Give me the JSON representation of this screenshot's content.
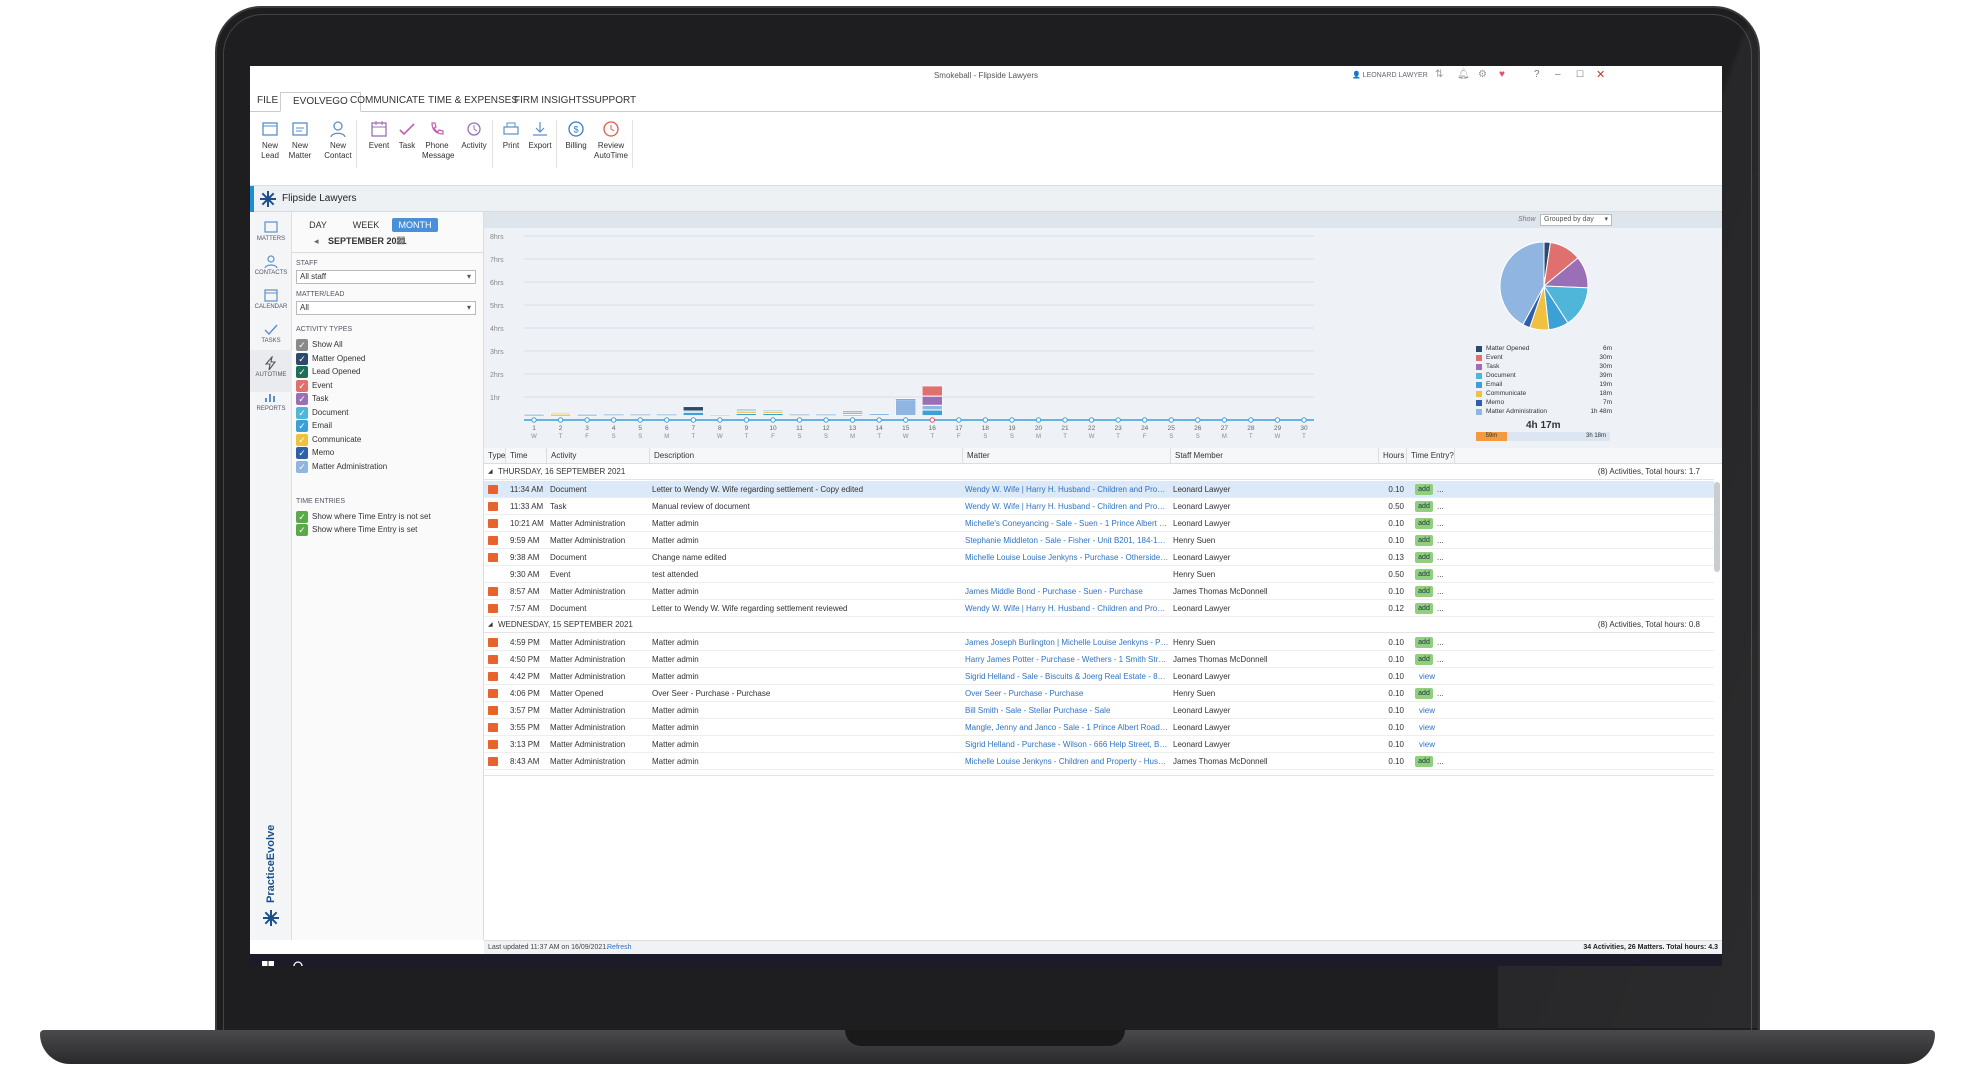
{
  "window": {
    "title": "Smokeball - Flipside Lawyers",
    "user": "LEONARD LAWYER"
  },
  "tabs": [
    "FILE",
    "EVOLVEGO",
    "COMMUNICATE",
    "TIME & EXPENSES",
    "FIRM INSIGHTS",
    "SUPPORT"
  ],
  "ribbon": [
    {
      "label": "New\nLead",
      "icon": "new-lead-icon"
    },
    {
      "label": "New\nMatter",
      "icon": "new-matter-icon"
    },
    {
      "label": "New\nContact",
      "icon": "new-contact-icon"
    },
    {
      "label": "Event",
      "icon": "event-icon"
    },
    {
      "label": "Task",
      "icon": "task-icon"
    },
    {
      "label": "Phone\nMessage",
      "icon": "phone-icon"
    },
    {
      "label": "Activity",
      "icon": "activity-icon"
    },
    {
      "label": "Print",
      "icon": "print-icon"
    },
    {
      "label": "Export",
      "icon": "export-icon"
    },
    {
      "label": "Billing",
      "icon": "billing-icon"
    },
    {
      "label": "Review\nAutoTime",
      "icon": "autotime-icon"
    }
  ],
  "firm": {
    "name": "Flipside Lawyers"
  },
  "nav": [
    "MATTERS",
    "CONTACTS",
    "CALENDAR",
    "TASKS",
    "AUTOTIME",
    "REPORTS"
  ],
  "brand": "PracticeEvolve",
  "filters": {
    "views": [
      "DAY",
      "WEEK",
      "MONTH"
    ],
    "month": "SEPTEMBER 2021",
    "staff_label": "STAFF",
    "staff_value": "All staff",
    "matter_label": "MATTER/LEAD",
    "matter_value": "All",
    "activity_label": "ACTIVITY TYPES",
    "activity_types": [
      {
        "label": "Show All",
        "color": "#8a8a8a"
      },
      {
        "label": "Matter Opened",
        "color": "#2b4a6e"
      },
      {
        "label": "Lead Opened",
        "color": "#1f6e5a"
      },
      {
        "label": "Event",
        "color": "#e07070"
      },
      {
        "label": "Task",
        "color": "#9b6fb8"
      },
      {
        "label": "Document",
        "color": "#4fb5d9"
      },
      {
        "label": "Email",
        "color": "#3aa0d6"
      },
      {
        "label": "Communicate",
        "color": "#f0c040"
      },
      {
        "label": "Memo",
        "color": "#2f5fa8"
      },
      {
        "label": "Matter Administration",
        "color": "#8fb5e0"
      }
    ],
    "time_label": "TIME ENTRIES",
    "time_options": [
      "Show where Time Entry is not set",
      "Show where Time Entry is set"
    ]
  },
  "chart_controls": {
    "show_label": "Show",
    "show_value": "Grouped by day"
  },
  "chart_data": {
    "type": "bar",
    "ylabels": [
      "8hrs",
      "7hrs",
      "6hrs",
      "5hrs",
      "4hrs",
      "3hrs",
      "2hrs",
      "1hr"
    ],
    "days": [
      "1",
      "2",
      "3",
      "4",
      "5",
      "6",
      "7",
      "8",
      "9",
      "10",
      "11",
      "12",
      "13",
      "14",
      "15",
      "16",
      "17",
      "18",
      "19",
      "20",
      "21",
      "22",
      "23",
      "24",
      "25",
      "26",
      "27",
      "28",
      "29",
      "30"
    ],
    "weekdays": [
      "W",
      "T",
      "F",
      "S",
      "S",
      "M",
      "T",
      "W",
      "T",
      "F",
      "S",
      "S",
      "M",
      "T",
      "W",
      "T",
      "F",
      "S",
      "S",
      "M",
      "T",
      "W",
      "T",
      "F",
      "S",
      "S",
      "M",
      "T",
      "W",
      "T"
    ],
    "stack_colors": [
      "#3aa0d6",
      "#f0c040",
      "#8fb5e0",
      "#9b6fb8",
      "#e07070",
      "#2b4a6e"
    ],
    "stacks": [
      [
        0.05,
        0,
        0.05,
        0,
        0,
        0
      ],
      [
        0.05,
        0.05,
        0.05,
        0,
        0,
        0
      ],
      [
        0.05,
        0,
        0.05,
        0,
        0,
        0
      ],
      [
        0,
        0,
        0,
        0,
        0,
        0
      ],
      [
        0,
        0,
        0,
        0,
        0,
        0
      ],
      [
        0,
        0,
        0,
        0,
        0,
        0
      ],
      [
        0.15,
        0,
        0.05,
        0,
        0,
        0.2
      ],
      [
        0,
        0,
        0.05,
        0,
        0,
        0
      ],
      [
        0.1,
        0.1,
        0.1,
        0,
        0,
        0
      ],
      [
        0.1,
        0.1,
        0.05,
        0,
        0,
        0
      ],
      [
        0,
        0,
        0,
        0,
        0,
        0
      ],
      [
        0,
        0,
        0,
        0,
        0,
        0
      ],
      [
        0.05,
        0,
        0.1,
        0,
        0,
        0.05
      ],
      [
        0,
        0,
        0.1,
        0,
        0,
        0
      ],
      [
        0,
        0,
        0.7,
        0,
        0,
        0.05
      ],
      [
        0.25,
        0,
        0.2,
        0.4,
        0.45,
        0
      ],
      [
        0,
        0,
        0,
        0,
        0,
        0
      ],
      [
        0,
        0,
        0,
        0,
        0,
        0
      ],
      [
        0,
        0,
        0,
        0,
        0,
        0
      ],
      [
        0,
        0,
        0,
        0,
        0,
        0
      ],
      [
        0,
        0,
        0,
        0,
        0,
        0
      ],
      [
        0,
        0,
        0,
        0,
        0,
        0
      ],
      [
        0,
        0,
        0,
        0,
        0,
        0
      ],
      [
        0,
        0,
        0,
        0,
        0,
        0
      ],
      [
        0,
        0,
        0,
        0,
        0,
        0
      ],
      [
        0,
        0,
        0,
        0,
        0,
        0
      ],
      [
        0,
        0,
        0,
        0,
        0,
        0
      ],
      [
        0,
        0,
        0,
        0,
        0,
        0
      ],
      [
        0,
        0,
        0,
        0,
        0,
        0
      ],
      [
        0,
        0,
        0,
        0,
        0,
        0
      ]
    ],
    "ymax": 8,
    "selected_day": "16",
    "pie": [
      {
        "label": "Matter Opened",
        "value": "6m",
        "minutes": 6,
        "color": "#2b4a6e"
      },
      {
        "label": "Event",
        "value": "30m",
        "minutes": 30,
        "color": "#e07070"
      },
      {
        "label": "Task",
        "value": "30m",
        "minutes": 30,
        "color": "#9b6fb8"
      },
      {
        "label": "Document",
        "value": "39m",
        "minutes": 39,
        "color": "#4fb5d9"
      },
      {
        "label": "Email",
        "value": "19m",
        "minutes": 19,
        "color": "#3aa0d6"
      },
      {
        "label": "Communicate",
        "value": "18m",
        "minutes": 18,
        "color": "#f0c040"
      },
      {
        "label": "Memo",
        "value": "7m",
        "minutes": 7,
        "color": "#2f5fa8"
      },
      {
        "label": "Matter Administration",
        "value": "1h 48m",
        "minutes": 108,
        "color": "#8fb5e0"
      }
    ],
    "total": "4h 17m",
    "split": {
      "left": "59m",
      "right": "3h 18m",
      "left_fraction": 0.23
    }
  },
  "columns": [
    "Type",
    "Time",
    "Activity",
    "Description",
    "Matter",
    "Staff Member",
    "Hours",
    "Time Entry?"
  ],
  "groups": [
    {
      "title": "THURSDAY, 16 SEPTEMBER 2021",
      "summary": "(8) Activities, Total hours: 1.7",
      "rows": [
        {
          "time": "11:34 AM",
          "activity": "Document",
          "description": "Letter to Wendy W. Wife regarding settlement - Copy edited",
          "matter": "Wendy W. Wife | Harry H. Husband - Children and Property -...",
          "staff": "Leonard Lawyer",
          "hours": "0.10",
          "entry": "add",
          "selected": true
        },
        {
          "time": "11:33 AM",
          "activity": "Task",
          "description": "Manual review of document",
          "matter": "Wendy W. Wife | Harry H. Husband - Children and Property -...",
          "staff": "Leonard Lawyer",
          "hours": "0.50",
          "entry": "add"
        },
        {
          "time": "10:21 AM",
          "activity": "Matter Administration",
          "description": "Matter admin",
          "matter": "Michelle's Coneyancing - Sale - Suen - 1 Prince Albert Road,...",
          "staff": "Leonard Lawyer",
          "hours": "0.10",
          "entry": "add"
        },
        {
          "time": "9:59 AM",
          "activity": "Matter Administration",
          "description": "Matter admin",
          "matter": "Stephanie Middleton - Sale - Fisher - Unit B201, 184-192 Res...",
          "staff": "Henry Suen",
          "hours": "0.10",
          "entry": "add"
        },
        {
          "time": "9:38 AM",
          "activity": "Document",
          "description": "Change name edited",
          "matter": "Michelle Louise Louise Jenkyns - Purchase - Otherside - 123...",
          "staff": "Leonard Lawyer",
          "hours": "0.13",
          "entry": "add"
        },
        {
          "time": "9:30 AM",
          "activity": "Event",
          "description": "test attended",
          "matter": "",
          "staff": "Henry Suen",
          "hours": "0.50",
          "entry": "add",
          "noicon": true
        },
        {
          "time": "8:57 AM",
          "activity": "Matter Administration",
          "description": "Matter admin",
          "matter": "James Middle Bond - Purchase - Suen - Purchase",
          "staff": "James Thomas McDonnell",
          "hours": "0.10",
          "entry": "add"
        },
        {
          "time": "7:57 AM",
          "activity": "Document",
          "description": "Letter to Wendy W. Wife regarding settlement reviewed",
          "matter": "Wendy W. Wife | Harry H. Husband - Children and Property -...",
          "staff": "Leonard Lawyer",
          "hours": "0.12",
          "entry": "add"
        }
      ]
    },
    {
      "title": "WEDNESDAY, 15 SEPTEMBER 2021",
      "summary": "(8) Activities, Total hours: 0.8",
      "rows": [
        {
          "time": "4:59 PM",
          "activity": "Matter Administration",
          "description": "Matter admin",
          "matter": "James Joseph Burlington | Michelle Louise Jenkyns - Purchas...",
          "staff": "Henry Suen",
          "hours": "0.10",
          "entry": "add"
        },
        {
          "time": "4:50 PM",
          "activity": "Matter Administration",
          "description": "Matter admin",
          "matter": "Harry James Potter - Purchase - Wethers - 1 Smith Street, Sm...",
          "staff": "James Thomas McDonnell",
          "hours": "0.10",
          "entry": "add"
        },
        {
          "time": "4:42 PM",
          "activity": "Matter Administration",
          "description": "Matter admin",
          "matter": "Sigrid Helland - Sale - Biscuits & Joerg Real Estate - 83 Hamil...",
          "staff": "Leonard Lawyer",
          "hours": "0.10",
          "entry": "view"
        },
        {
          "time": "4:06 PM",
          "activity": "Matter Opened",
          "description": "Over Seer - Purchase - Purchase",
          "matter": "Over Seer - Purchase - Purchase",
          "staff": "Henry Suen",
          "hours": "0.10",
          "entry": "add"
        },
        {
          "time": "3:57 PM",
          "activity": "Matter Administration",
          "description": "Matter admin",
          "matter": "Bill Smith - Sale - Stellar Purchase - Sale",
          "staff": "Leonard Lawyer",
          "hours": "0.10",
          "entry": "view"
        },
        {
          "time": "3:55 PM",
          "activity": "Matter Administration",
          "description": "Matter admin",
          "matter": "Mangle, Jenny and Janco - Sale - 1 Prince Albert Road, Sydne...",
          "staff": "Leonard Lawyer",
          "hours": "0.10",
          "entry": "view"
        },
        {
          "time": "3:13 PM",
          "activity": "Matter Administration",
          "description": "Matter admin",
          "matter": "Sigrid Helland - Purchase - Wilson - 666 Help Street, Brisban...",
          "staff": "Leonard Lawyer",
          "hours": "0.10",
          "entry": "view"
        },
        {
          "time": "8:43 AM",
          "activity": "Matter Administration",
          "description": "Matter admin",
          "matter": "Michelle Louise Jenkyns - Children and Property - Husband -...",
          "staff": "James Thomas McDonnell",
          "hours": "0.10",
          "entry": "add"
        }
      ]
    }
  ],
  "status": {
    "updated": "Last updated 11:37 AM on 16/09/2021.",
    "refresh": "Refresh",
    "summary": "34 Activities, 26 Matters. Total hours: 4.3"
  }
}
